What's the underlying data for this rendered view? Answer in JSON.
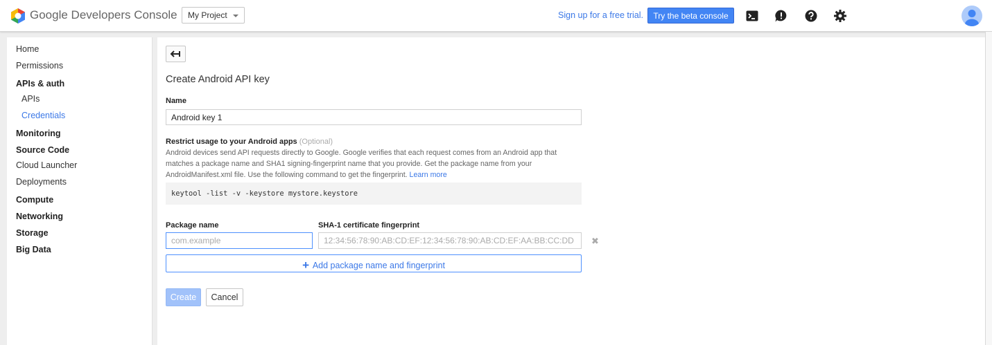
{
  "header": {
    "app_title": "Google Developers Console",
    "project": "My Project",
    "signup_link": "Sign up for a free trial.",
    "beta_button": "Try the beta console",
    "icons": [
      "cloud-shell-icon",
      "feedback-icon",
      "help-icon",
      "settings-icon",
      "avatar"
    ]
  },
  "sidebar": {
    "items": [
      {
        "label": "Home"
      },
      {
        "label": "Permissions"
      },
      {
        "label": "APIs & auth"
      },
      {
        "label": "APIs"
      },
      {
        "label": "Credentials"
      },
      {
        "label": "Monitoring"
      },
      {
        "label": "Source Code"
      },
      {
        "label": "Cloud Launcher"
      },
      {
        "label": "Deployments"
      },
      {
        "label": "Compute"
      },
      {
        "label": "Networking"
      },
      {
        "label": "Storage"
      },
      {
        "label": "Big Data"
      }
    ]
  },
  "main": {
    "title": "Create Android API key",
    "name_label": "Name",
    "name_value": "Android key 1",
    "restrict_label": "Restrict usage to your Android apps",
    "restrict_optional": "(Optional)",
    "description": "Android devices send API requests directly to Google. Google verifies that each request comes from an Android app that matches a package name and SHA1 signing-fingerprint name that you provide. Get the package name from your AndroidManifest.xml file. Use the following command to get the fingerprint.",
    "learn_more": "Learn more",
    "command": "keytool -list -v -keystore mystore.keystore",
    "package_label": "Package name",
    "package_placeholder": "com.example",
    "sha_label": "SHA-1 certificate fingerprint",
    "sha_placeholder": "12:34:56:78:90:AB:CD:EF:12:34:56:78:90:AB:CD:EF:AA:BB:CC:DD",
    "add_button": "Add package name and fingerprint",
    "create_button": "Create",
    "cancel_button": "Cancel"
  },
  "colors": {
    "accent": "#4285f4",
    "link": "#3b78e7",
    "create_disabled": "#a1c2fa"
  }
}
